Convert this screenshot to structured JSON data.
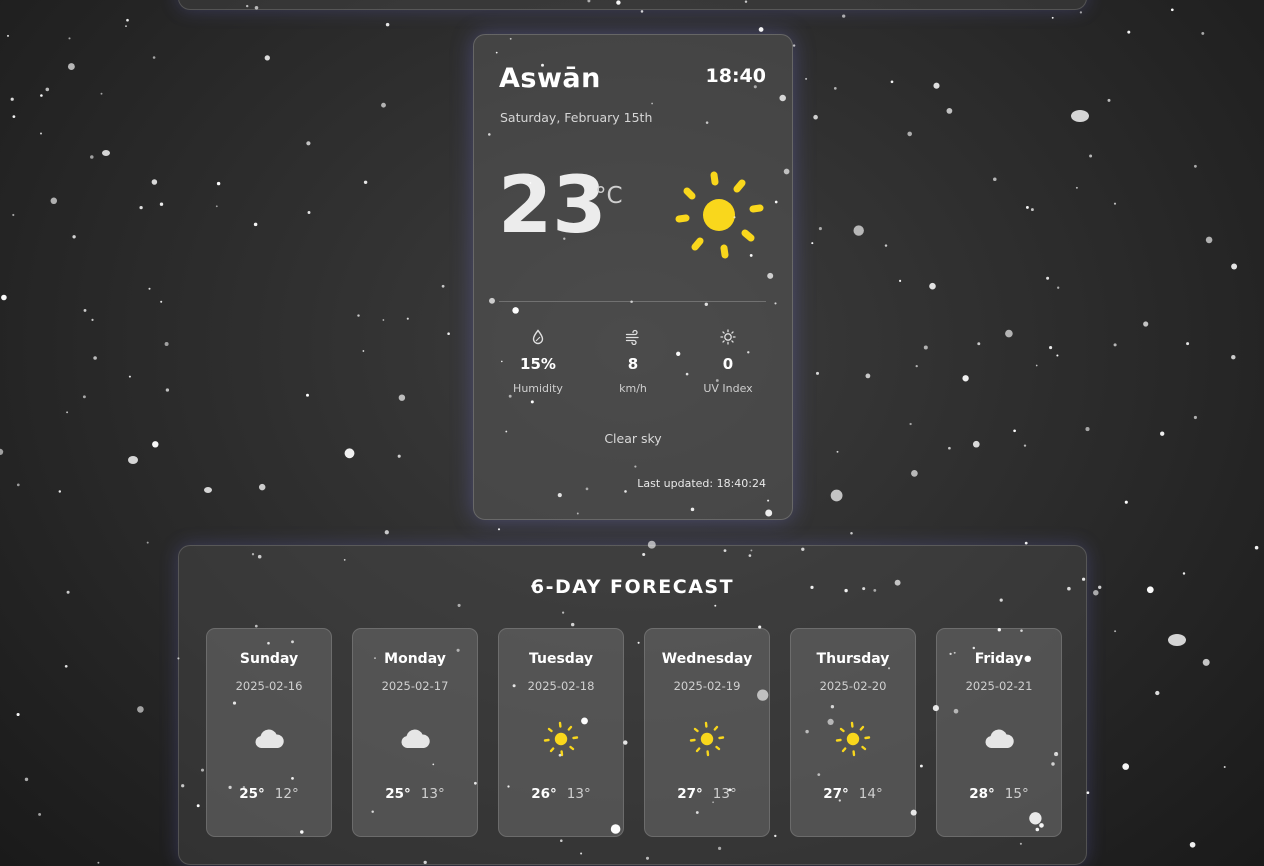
{
  "weather": {
    "city": "Aswān",
    "time": "18:40",
    "date": "Saturday, February 15th",
    "temperature": "23",
    "unit": "°C",
    "icon": "sun-icon",
    "stats": [
      {
        "icon": "humidity-icon",
        "value": "15%",
        "label": "Humidity"
      },
      {
        "icon": "wind-icon",
        "value": "8",
        "label": "km/h"
      },
      {
        "icon": "uv-icon",
        "value": "0",
        "label": "UV Index"
      }
    ],
    "condition": "Clear sky",
    "last_updated": "Last updated: 18:40:24"
  },
  "forecast": {
    "title": "6-DAY FORECAST",
    "days": [
      {
        "name": "Sunday",
        "date": "2025-02-16",
        "icon": "cloud-icon",
        "high": "25°",
        "low": "12°"
      },
      {
        "name": "Monday",
        "date": "2025-02-17",
        "icon": "cloud-icon",
        "high": "25°",
        "low": "13°"
      },
      {
        "name": "Tuesday",
        "date": "2025-02-18",
        "icon": "sun-icon",
        "high": "26°",
        "low": "13°"
      },
      {
        "name": "Wednesday",
        "date": "2025-02-19",
        "icon": "sun-icon",
        "high": "27°",
        "low": "13°"
      },
      {
        "name": "Thursday",
        "date": "2025-02-20",
        "icon": "sun-icon",
        "high": "27°",
        "low": "14°"
      },
      {
        "name": "Friday",
        "date": "2025-02-21",
        "icon": "cloud-icon",
        "high": "28°",
        "low": "15°"
      }
    ]
  },
  "colors": {
    "sun": "#f9d71c",
    "cloud": "#e6e6e6",
    "accent_glow": "#7878e6"
  }
}
